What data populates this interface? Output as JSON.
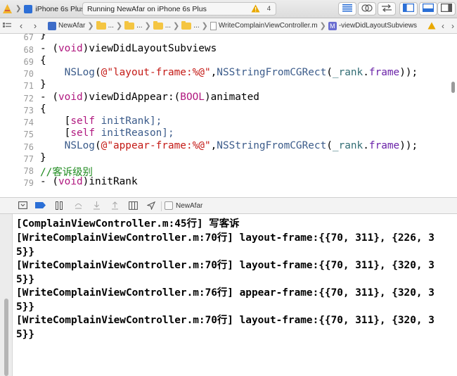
{
  "toolbar": {
    "device": "iPhone 6s Plus",
    "status": "Running NewAfar on iPhone 6s Plus",
    "warning_count": "4"
  },
  "jumpbar": {
    "project": "NewAfar",
    "ellipsis_1": "...",
    "ellipsis_2": "...",
    "ellipsis_3": "...",
    "ellipsis_4": "...",
    "file": "WriteComplainViewController.m",
    "method_badge": "M",
    "method": "-viewDidLayoutSubviews"
  },
  "editor": {
    "line_numbers": [
      "67",
      "68",
      "69",
      "70",
      "71",
      "72",
      "73",
      "74",
      "75",
      "76",
      "77",
      "78",
      "79"
    ],
    "lines": {
      "l67": "}",
      "l68_dash": "- (",
      "l68_kw": "void",
      "l68_rest": ")viewDidLayoutSubviews",
      "l69": "{",
      "l70_indent": "    ",
      "l70_fn": "NSLog",
      "l70_open": "(",
      "l70_str": "@\"layout-frame:%@\"",
      "l70_comma": ",",
      "l70_fn2": "NSStringFromCGRect",
      "l70_p1": "(",
      "l70_var": "_rank",
      "l70_dot": ".",
      "l70_prop": "frame",
      "l70_end": "));",
      "l71": "}",
      "l72_dash": "- (",
      "l72_kw": "void",
      "l72_mid": ")viewDidAppear:(",
      "l72_kw2": "BOOL",
      "l72_rest": ")animated",
      "l73": "{",
      "l74_indent": "    [",
      "l74_kw": "self",
      "l74_rest": " initRank];",
      "l75_indent": "    [",
      "l75_kw": "self",
      "l75_rest": " initReason];",
      "l76_indent": "    ",
      "l76_fn": "NSLog",
      "l76_open": "(",
      "l76_str": "@\"appear-frame:%@\"",
      "l76_comma": ",",
      "l76_fn2": "NSStringFromCGRect",
      "l76_p1": "(",
      "l76_var": "_rank",
      "l76_dot": ".",
      "l76_prop": "frame",
      "l76_end": "));",
      "l77": "}",
      "l78": "//客诉级别",
      "l79_dash": "- (",
      "l79_kw": "void",
      "l79_rest": ")initRank"
    }
  },
  "debugbar": {
    "target": "NewAfar"
  },
  "console": {
    "lines": [
      "[ComplainViewController.m:45行] 写客诉",
      "[WriteComplainViewController.m:70行] layout-frame:{{70, 311}, {226, 35}}",
      "[WriteComplainViewController.m:70行] layout-frame:{{70, 311}, {320, 35}}",
      "[WriteComplainViewController.m:76行] appear-frame:{{70, 311}, {320, 35}}",
      "[WriteComplainViewController.m:70行] layout-frame:{{70, 311}, {320, 35}}"
    ]
  },
  "colors": {
    "keyword": "#b0187f",
    "string": "#c41a16",
    "function": "#3b5b8a",
    "comment": "#1e8a1e",
    "property": "#6a22a8",
    "warning": "#e8a800",
    "device_icon": "#2d6fd6",
    "toolbar_icon": "#2b6fd6"
  }
}
